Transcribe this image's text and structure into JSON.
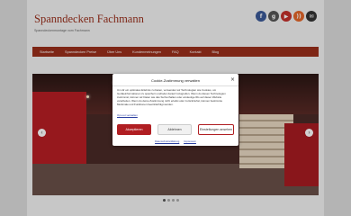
{
  "site": {
    "title": "Spanndecken Fachmann",
    "tagline": "Spanndeckenmontage vom Fachmann"
  },
  "social": [
    {
      "icon": "facebook-icon",
      "glyph": "f",
      "color": "#3b5998"
    },
    {
      "icon": "google-plus-icon",
      "glyph": "g",
      "color": "#555555"
    },
    {
      "icon": "youtube-icon",
      "glyph": "▶",
      "color": "#c4302b"
    },
    {
      "icon": "rss-icon",
      "glyph": "))",
      "color": "#e5672a"
    },
    {
      "icon": "email-icon",
      "glyph": "✉",
      "color": "#333333"
    }
  ],
  "nav": [
    "Startseite",
    "Spanndecken Preise",
    "Über Uns",
    "Kundenmeinungen",
    "FAQ",
    "Kontakt",
    "Blog"
  ],
  "slider": {
    "prev": "‹",
    "next": "›",
    "dots": 4,
    "active_dot": 0
  },
  "consent": {
    "title": "Cookie-Zustimmung verwalten",
    "close": "×",
    "body": "Um dir ein optimales Erlebnis zu bieten, verwenden wir Technologien wie Cookies, um Geräteinformationen zu speichern und/oder darauf zuzugreifen. Wenn du diesen Technologien zustimmst, können wir Daten wie das Surfverhalten oder eindeutige IDs auf dieser Website verarbeiten. Wenn du deine Zustimmung nicht erteilst oder zurückziehst, können bestimmte Merkmale und Funktionen beeinträchtigt werden.",
    "link": "Opt-out verwalten",
    "accept": "Akzeptieren",
    "reject": "Ablehnen",
    "settings": "Einstellungen ansehen",
    "footer_links": [
      "Datenschutzerklärung",
      "Impressum"
    ]
  }
}
